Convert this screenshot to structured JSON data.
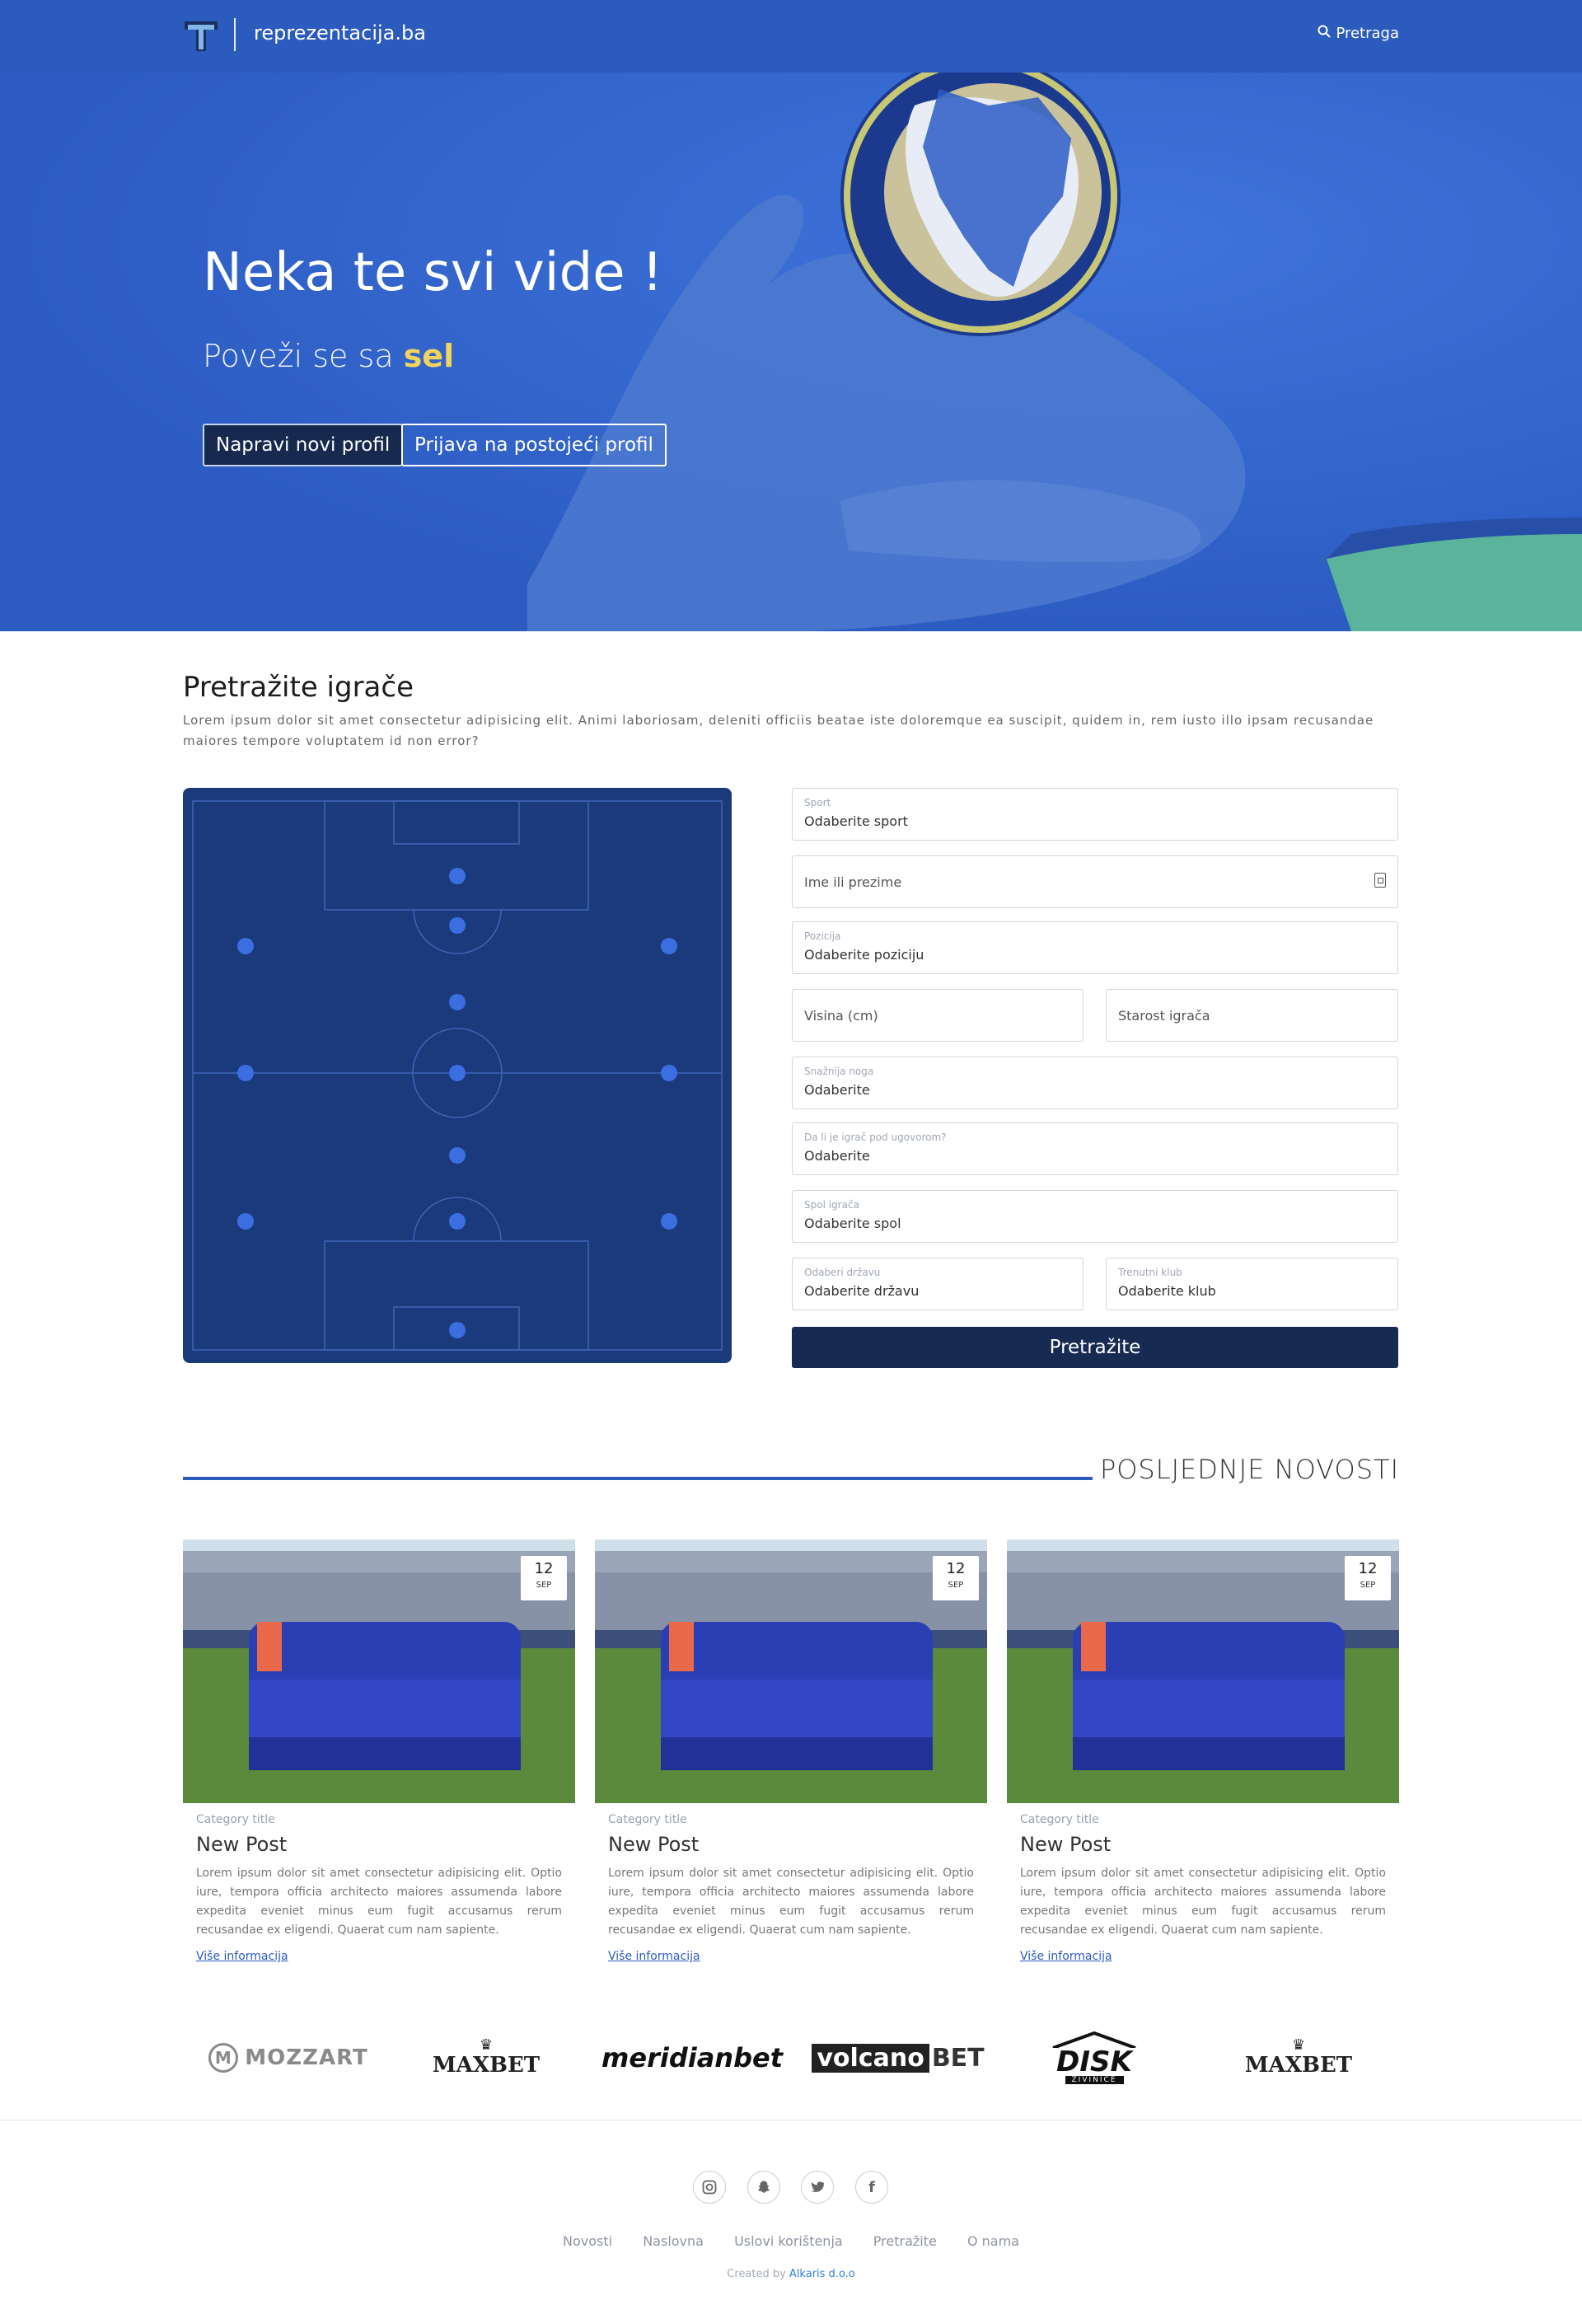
{
  "nav": {
    "site_name": "reprezentacija.ba",
    "search_label": "Pretraga"
  },
  "hero": {
    "title": "Neka te svi vide !",
    "subtitle_prefix": "Poveži se sa ",
    "subtitle_highlight": "sel",
    "btn_new_profile": "Napravi novi profil",
    "btn_login": "Prijava na postojeći profil"
  },
  "search": {
    "title": "Pretražite igrače",
    "description": "Lorem ipsum dolor sit amet consectetur adipisicing elit. Animi laboriosam, deleniti officiis beatae iste doloremque ea suscipit, quidem in, rem iusto illo ipsam recusandae maiores tempore voluptatem id non error?",
    "fields": {
      "sport": {
        "label": "Sport",
        "value": "Odaberite sport"
      },
      "name": {
        "placeholder": "Ime ili prezime"
      },
      "position": {
        "label": "Pozicija",
        "value": "Odaberite poziciju"
      },
      "height": {
        "placeholder": "Visina (cm)"
      },
      "age": {
        "placeholder": "Starost igrača"
      },
      "foot": {
        "label": "Snažnija noga",
        "value": "Odaberite"
      },
      "contract": {
        "label": "Da li je igrač pod ugovorom?",
        "value": "Odaberite"
      },
      "gender": {
        "label": "Spol igrača",
        "value": "Odaberite spol"
      },
      "country": {
        "label": "Odaberi državu",
        "value": "Odaberite državu"
      },
      "club": {
        "label": "Trenutni klub",
        "value": "Odaberite klub"
      }
    },
    "submit": "Pretražite"
  },
  "news": {
    "title": "POSLJEDNJE NOVOSTI",
    "cards": [
      {
        "day": "12",
        "month": "SEP",
        "category": "Category title",
        "title": "New Post",
        "text": "Lorem ipsum dolor sit amet consectetur adipisicing elit. Optio iure, tempora officia architecto maiores assumenda labore expedita eveniet minus eum fugit accusamus rerum recusandae ex eligendi. Quaerat cum nam sapiente.",
        "more": "Više informacija"
      },
      {
        "day": "12",
        "month": "SEP",
        "category": "Category title",
        "title": "New Post",
        "text": "Lorem ipsum dolor sit amet consectetur adipisicing elit. Optio iure, tempora officia architecto maiores assumenda labore expedita eveniet minus eum fugit accusamus rerum recusandae ex eligendi. Quaerat cum nam sapiente.",
        "more": "Više informacija"
      },
      {
        "day": "12",
        "month": "SEP",
        "category": "Category title",
        "title": "New Post",
        "text": "Lorem ipsum dolor sit amet consectetur adipisicing elit. Optio iure, tempora officia architecto maiores assumenda labore expedita eveniet minus eum fugit accusamus rerum recusandae ex eligendi. Quaerat cum nam sapiente.",
        "more": "Više informacija"
      }
    ]
  },
  "sponsors": {
    "mozzart": "MOZZART",
    "maxbet": "MAXBET",
    "meridian": "meridianbet",
    "volcano_a": "volcano",
    "volcano_b": "BET",
    "disk": "DISK",
    "disk_sub": "ŽIVINICE"
  },
  "footer": {
    "social_icons": [
      "instagram-icon",
      "snapchat-icon",
      "twitter-icon",
      "facebook-icon"
    ],
    "links": [
      "Novosti",
      "Naslovna",
      "Uslovi korištenja",
      "Pretražite",
      "O nama"
    ],
    "credit_prefix": "Created by ",
    "credit_company": "Alkaris d.o.o"
  },
  "colors": {
    "brand_blue": "#2b5bbd",
    "navy": "#172a52",
    "pitch": "#1a3a7c",
    "highlight_yellow": "#f0d45c"
  }
}
